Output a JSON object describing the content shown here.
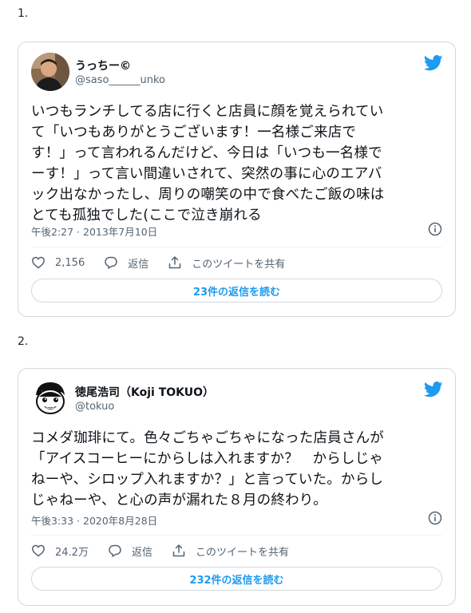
{
  "colors": {
    "accent": "#1d9bf0",
    "text": "#0f1419",
    "muted": "#536471",
    "border": "#cfd9de"
  },
  "tweets": [
    {
      "number": "1.",
      "author_name": "うっちー©",
      "handle": "@saso______unko",
      "avatar_icon": "user-avatar-photo",
      "body": "いつもランチしてる店に行くと店員に顔を覚えられてい\nて「いつもありがとうございます！一名様ご来店で\nす！」って言われるんだけど、今日は「いつも一名様で\nーす！」って言い間違いされて、突然の事に心のエアバ\nック出なかったし、周りの嘲笑の中で食べたご飯の味は\nとても孤独でした(ここで泣き崩れる",
      "timestamp": "午後2:27 · 2013年7月10日",
      "like_count": "2,156",
      "reply_label": "返信",
      "share_label": "このツイートを共有",
      "replies_button": "23件の返信を読む"
    },
    {
      "number": "2.",
      "author_name": "徳尾浩司（Koji TOKUO）",
      "handle": "@tokuo",
      "avatar_icon": "cartoon-face-avatar",
      "body": "コメダ珈琲にて。色々ごちゃごちゃになった店員さんが\n「アイスコーヒーにからしは入れますか？　からしじゃ\nねーや、シロップ入れますか？」と言っていた。からし\nじゃねーや、と心の声が漏れた８月の終わり。",
      "timestamp": "午後3:33 · 2020年8月28日",
      "like_count": "24.2万",
      "reply_label": "返信",
      "share_label": "このツイートを共有",
      "replies_button": "232件の返信を読む"
    }
  ]
}
